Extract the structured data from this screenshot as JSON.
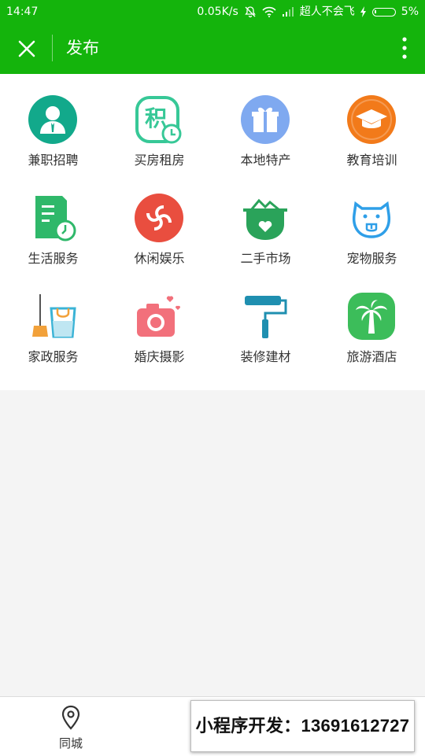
{
  "status_bar": {
    "time": "14:47",
    "speed": "0.05K/s",
    "carrier": "超人不会飞",
    "battery": "5%"
  },
  "header": {
    "title": "发布"
  },
  "categories": [
    {
      "label": "兼职招聘",
      "icon": "recruitment-icon",
      "color": "#12a98b"
    },
    {
      "label": "买房租房",
      "icon": "housing-icon",
      "color": "#37c897"
    },
    {
      "label": "本地特产",
      "icon": "gift-icon",
      "color": "#7fa9f0"
    },
    {
      "label": "教育培训",
      "icon": "graduation-cap-icon",
      "color": "#f27a1a"
    },
    {
      "label": "生活服务",
      "icon": "life-service-icon",
      "color": "#2fb86a"
    },
    {
      "label": "休闲娱乐",
      "icon": "leisure-icon",
      "color": "#e94e3f"
    },
    {
      "label": "二手市场",
      "icon": "second-hand-icon",
      "color": "#2aa35a"
    },
    {
      "label": "宠物服务",
      "icon": "pet-icon",
      "color": "#2f9fe8"
    },
    {
      "label": "家政服务",
      "icon": "housekeeping-icon",
      "color": "#3ab3d6"
    },
    {
      "label": "婚庆摄影",
      "icon": "camera-icon",
      "color": "#f2707b"
    },
    {
      "label": "装修建材",
      "icon": "paint-roller-icon",
      "color": "#1f8fb0"
    },
    {
      "label": "旅游酒店",
      "icon": "palm-tree-icon",
      "color": "#3cbd5a"
    }
  ],
  "tabbar": {
    "city_label": "同城"
  },
  "promo": {
    "text": "小程序开发：13691612727"
  }
}
